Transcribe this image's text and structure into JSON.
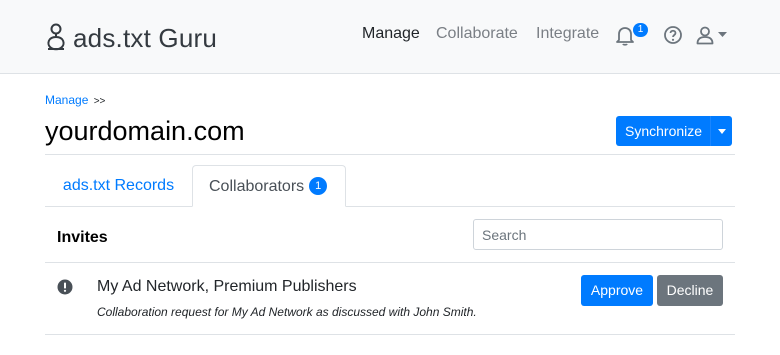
{
  "navbar": {
    "brand": "ads.txt Guru",
    "links": {
      "manage": "Manage",
      "collaborate": "Collaborate",
      "integrate": "Integrate"
    },
    "notification_count": "1",
    "icons": [
      "bell-icon",
      "help-circle-icon",
      "user-icon",
      "caret-down-icon"
    ]
  },
  "breadcrumb": {
    "link": "Manage",
    "separator": ">>"
  },
  "page": {
    "title": "yourdomain.com",
    "sync_label": "Synchronize"
  },
  "tabs": {
    "records": "ads.txt Records",
    "collaborators": "Collaborators",
    "collaborators_count": "1"
  },
  "invites": {
    "title": "Invites",
    "search_placeholder": "Search",
    "items": [
      {
        "name": "My Ad Network, Premium Publishers",
        "description": "Collaboration request for My Ad Network as discussed with John Smith.",
        "approve_label": "Approve",
        "decline_label": "Decline",
        "icon": "exclamation-circle-icon"
      }
    ]
  },
  "colors": {
    "primary": "#007bff",
    "secondary": "#6c757d",
    "navbar_bg": "#f8f9fa"
  }
}
